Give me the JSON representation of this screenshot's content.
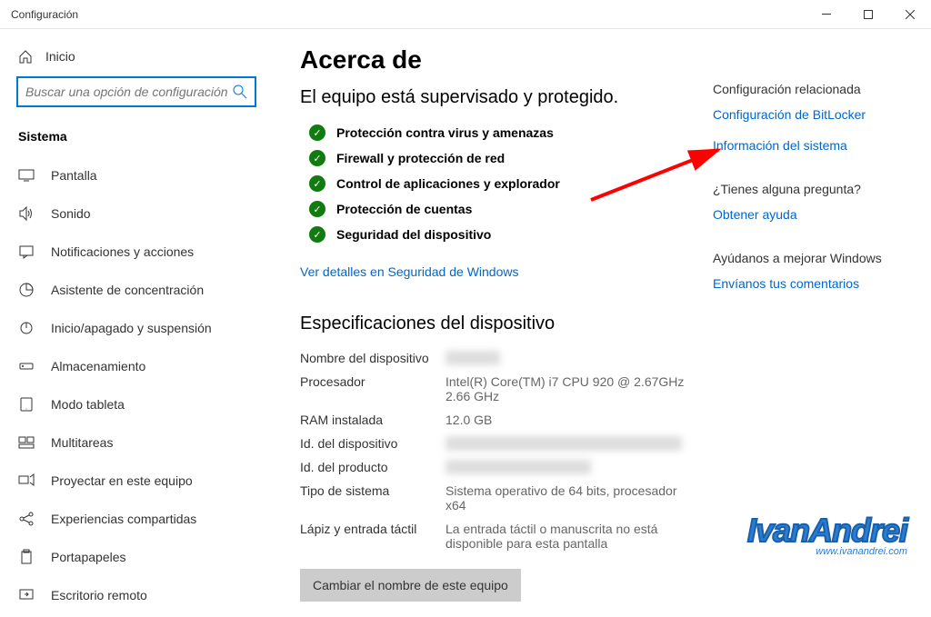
{
  "window": {
    "title": "Configuración"
  },
  "sidebar": {
    "home": "Inicio",
    "search_placeholder": "Buscar una opción de configuración",
    "header": "Sistema",
    "items": [
      {
        "label": "Pantalla"
      },
      {
        "label": "Sonido"
      },
      {
        "label": "Notificaciones y acciones"
      },
      {
        "label": "Asistente de concentración"
      },
      {
        "label": "Inicio/apagado y suspensión"
      },
      {
        "label": "Almacenamiento"
      },
      {
        "label": "Modo tableta"
      },
      {
        "label": "Multitareas"
      },
      {
        "label": "Proyectar en este equipo"
      },
      {
        "label": "Experiencias compartidas"
      },
      {
        "label": "Portapapeles"
      },
      {
        "label": "Escritorio remoto"
      }
    ]
  },
  "main": {
    "title": "Acerca de",
    "protection_title": "El equipo está supervisado y protegido.",
    "protection_items": [
      "Protección contra virus y amenazas",
      "Firewall y protección de red",
      "Control de aplicaciones y explorador",
      "Protección de cuentas",
      "Seguridad del dispositivo"
    ],
    "details_link": "Ver detalles en Seguridad de Windows",
    "specs_title": "Especificaciones del dispositivo",
    "specs": {
      "device_name_label": "Nombre del dispositivo",
      "device_name_value": "REDACTED",
      "processor_label": "Procesador",
      "processor_value": "Intel(R) Core(TM) i7 CPU         920  @ 2.67GHz   2.66 GHz",
      "ram_label": "RAM instalada",
      "ram_value": "12.0 GB",
      "device_id_label": "Id. del dispositivo",
      "device_id_value": "REDACTED-REDACTED-REDACTED-REDACTED",
      "product_id_label": "Id. del producto",
      "product_id_value": "REDACTED-REDACTED",
      "system_type_label": "Tipo de sistema",
      "system_type_value": "Sistema operativo de 64 bits, procesador x64",
      "pen_label": "Lápiz y entrada táctil",
      "pen_value": "La entrada táctil o manuscrita no está disponible para esta pantalla"
    },
    "rename_button": "Cambiar el nombre de este equipo"
  },
  "related": {
    "heading1": "Configuración relacionada",
    "link1": "Configuración de BitLocker",
    "link2": "Información del sistema",
    "heading2": "¿Tienes alguna pregunta?",
    "link3": "Obtener ayuda",
    "heading3": "Ayúdanos a mejorar Windows",
    "link4": "Envíanos tus comentarios"
  },
  "watermark": {
    "main": "IvanAndrei",
    "sub": "www.ivanandrei.com"
  }
}
